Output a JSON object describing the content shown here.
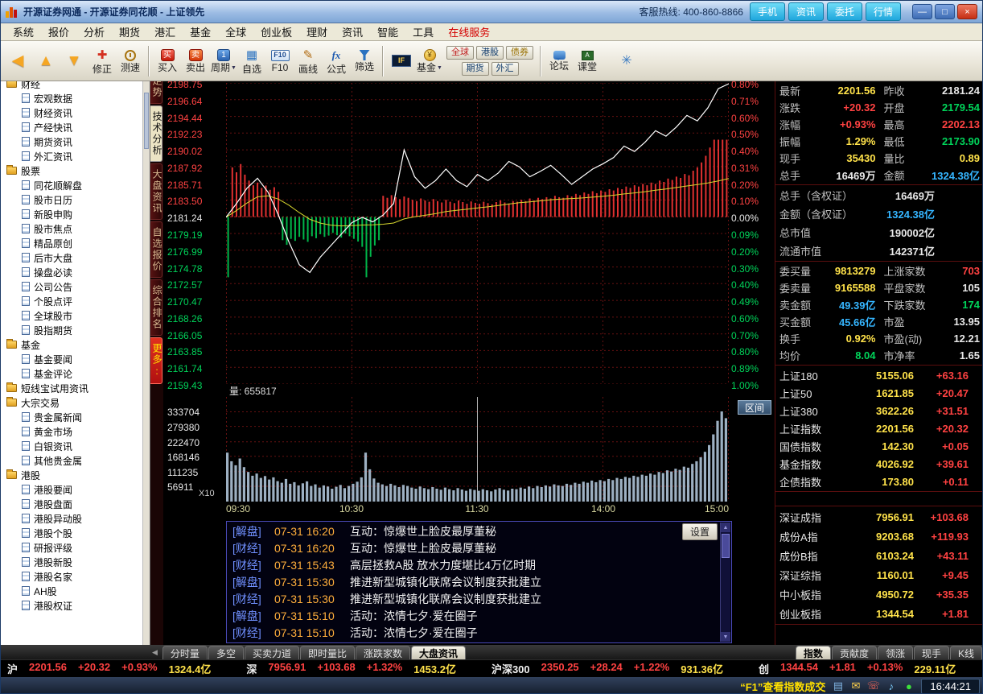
{
  "window": {
    "title": "开源证券网通 - 开源证券同花顺 - 上证领先",
    "hotline": "客服热线: 400-860-8866",
    "quick_buttons": [
      {
        "id": "mobile",
        "label": "手机"
      },
      {
        "id": "info",
        "label": "资讯"
      },
      {
        "id": "trade",
        "label": "委托"
      },
      {
        "id": "quotes",
        "label": "行情"
      }
    ],
    "controls": [
      {
        "id": "minimize",
        "glyph": "—"
      },
      {
        "id": "restore",
        "glyph": "□"
      },
      {
        "id": "close",
        "glyph": "×"
      }
    ]
  },
  "menubar": {
    "items": [
      {
        "id": "system",
        "label": "系统"
      },
      {
        "id": "quote",
        "label": "报价"
      },
      {
        "id": "analysis",
        "label": "分析"
      },
      {
        "id": "futures",
        "label": "期货"
      },
      {
        "id": "hk-fx",
        "label": "港汇"
      },
      {
        "id": "fund",
        "label": "基金"
      },
      {
        "id": "global",
        "label": "全球"
      },
      {
        "id": "chinext",
        "label": "创业板"
      },
      {
        "id": "wealth",
        "label": "理财"
      },
      {
        "id": "news",
        "label": "资讯"
      },
      {
        "id": "smart",
        "label": "智能"
      },
      {
        "id": "tools",
        "label": "工具"
      },
      {
        "id": "online-service",
        "label": "在线服务",
        "accent": true
      }
    ]
  },
  "toolbar": {
    "items": [
      {
        "type": "btn",
        "id": "back",
        "icon": "nav",
        "glyph": "◀"
      },
      {
        "type": "btn",
        "id": "home",
        "icon": "nav",
        "glyph": "▲"
      },
      {
        "type": "btn",
        "id": "forward",
        "icon": "nav",
        "glyph": "▼"
      },
      {
        "type": "btn",
        "id": "revise",
        "icon": "revise",
        "glyph": "✚",
        "label": "修正"
      },
      {
        "type": "btn",
        "id": "speed-test",
        "icon": "clock",
        "label": "测速"
      },
      {
        "type": "sep"
      },
      {
        "type": "btn",
        "id": "buy",
        "icon": "buy",
        "glyph": "买",
        "label": "买入"
      },
      {
        "type": "btn",
        "id": "sell",
        "icon": "sell",
        "glyph": "卖",
        "label": "卖出"
      },
      {
        "type": "btn",
        "id": "period",
        "icon": "period",
        "glyph": "1",
        "label": "周期",
        "dropdown": true
      },
      {
        "type": "btn",
        "id": "watchlist",
        "icon": "grid",
        "glyph": "▦",
        "label": "自选"
      },
      {
        "type": "btn",
        "id": "f10",
        "icon": "f10",
        "glyph": "F10",
        "label": "F10"
      },
      {
        "type": "btn",
        "id": "draw-line",
        "icon": "pencil",
        "glyph": "✎",
        "label": "画线"
      },
      {
        "type": "btn",
        "id": "formula",
        "icon": "fx",
        "glyph": "fx",
        "label": "公式"
      },
      {
        "type": "btn",
        "id": "screener",
        "icon": "funnel",
        "label": "筛选"
      },
      {
        "type": "sep"
      },
      {
        "type": "btn",
        "id": "index-futures",
        "icon": "if",
        "glyph": "IF"
      },
      {
        "type": "btn",
        "id": "fund",
        "icon": "coin",
        "glyph": "¥",
        "label": "基金",
        "dropdown": true
      },
      {
        "type": "group",
        "id": "market-shortcuts",
        "rows": [
          [
            {
              "id": "global",
              "label": "全球",
              "color": "#c02020"
            },
            {
              "id": "hk",
              "label": "港股",
              "color": "#103a6a"
            },
            {
              "id": "bond",
              "label": "债券",
              "color": "#9a7000"
            }
          ],
          [
            {
              "id": "futures",
              "label": "期货",
              "color": "#103a6a"
            },
            {
              "id": "fx",
              "label": "外汇",
              "color": "#103a6a"
            }
          ]
        ]
      },
      {
        "type": "sep"
      },
      {
        "type": "btn",
        "id": "forum",
        "icon": "forum",
        "label": "论坛"
      },
      {
        "type": "btn",
        "id": "classroom",
        "icon": "class",
        "glyph": "A",
        "label": "课堂"
      },
      {
        "type": "btn",
        "id": "settings",
        "icon": "gear",
        "glyph": "✳"
      }
    ]
  },
  "sidebar": {
    "items": [
      {
        "label": "财经",
        "level": 0
      },
      {
        "label": "宏观数据",
        "level": 1
      },
      {
        "label": "财经资讯",
        "level": 1
      },
      {
        "label": "产经快讯",
        "level": 1
      },
      {
        "label": "期货资讯",
        "level": 1
      },
      {
        "label": "外汇资讯",
        "level": 1
      },
      {
        "label": "股票",
        "level": 0
      },
      {
        "label": "同花顺解盘",
        "level": 1
      },
      {
        "label": "股市日历",
        "level": 1
      },
      {
        "label": "新股申购",
        "level": 1
      },
      {
        "label": "股市焦点",
        "level": 1
      },
      {
        "label": "精品原创",
        "level": 1
      },
      {
        "label": "后市大盘",
        "level": 1
      },
      {
        "label": "操盘必读",
        "level": 1
      },
      {
        "label": "公司公告",
        "level": 1
      },
      {
        "label": "个股点评",
        "level": 1
      },
      {
        "label": "全球股市",
        "level": 1
      },
      {
        "label": "股指期货",
        "level": 1
      },
      {
        "label": "基金",
        "level": 0
      },
      {
        "label": "基金要闻",
        "level": 1
      },
      {
        "label": "基金评论",
        "level": 1
      },
      {
        "label": "短线宝试用资讯",
        "level": 0
      },
      {
        "label": "大宗交易",
        "level": 0
      },
      {
        "label": "贵金属新闻",
        "level": 1
      },
      {
        "label": "黄金市场",
        "level": 1
      },
      {
        "label": "白银资讯",
        "level": 1
      },
      {
        "label": "其他贵金属",
        "level": 1
      },
      {
        "label": "港股",
        "level": 0
      },
      {
        "label": "港股要闻",
        "level": 1
      },
      {
        "label": "港股盘面",
        "level": 1
      },
      {
        "label": "港股异动股",
        "level": 1
      },
      {
        "label": "港股个股",
        "level": 1
      },
      {
        "label": "研报评级",
        "level": 1
      },
      {
        "label": "港股新股",
        "level": 1
      },
      {
        "label": "港股名家",
        "level": 1
      },
      {
        "label": "AH股",
        "level": 1
      },
      {
        "label": "港股权证",
        "level": 1
      }
    ]
  },
  "vertical_tabs": {
    "items": [
      {
        "id": "trend",
        "label": "走势"
      },
      {
        "id": "technical",
        "label": "技术分析",
        "selected": true
      },
      {
        "id": "market-info",
        "label": "大盘资讯"
      },
      {
        "id": "watchlist-quotes",
        "label": "自选报价"
      },
      {
        "id": "ranking",
        "label": "综合排名"
      },
      {
        "id": "more",
        "label": "更多:",
        "accent": true
      }
    ]
  },
  "chart_data": {
    "type": "intraday-line",
    "prev_close": 2181.24,
    "axis_top_value": 2198.75,
    "axis_bottom_value": 2159.43,
    "left_axis_labels": [
      "2198.75",
      "2196.64",
      "2194.44",
      "2192.23",
      "2190.02",
      "2187.92",
      "2185.71",
      "2183.50",
      "2181.24",
      "2179.19",
      "2176.99",
      "2174.78",
      "2172.57",
      "2170.47",
      "2168.26",
      "2166.05",
      "2163.85",
      "2161.74",
      "2159.43"
    ],
    "right_axis_labels": [
      "0.80%",
      "0.71%",
      "0.60%",
      "0.50%",
      "0.40%",
      "0.31%",
      "0.20%",
      "0.10%",
      "0.00%",
      "0.09%",
      "0.20%",
      "0.30%",
      "0.40%",
      "0.49%",
      "0.60%",
      "0.70%",
      "0.80%",
      "0.89%",
      "1.00%"
    ],
    "time_labels": [
      "09:30",
      "10:30",
      "11:30",
      "14:00",
      "15:00"
    ],
    "price_series": [
      2181.2,
      2183.0,
      2185.0,
      2186.3,
      2184.5,
      2181.5,
      2178.0,
      2175.0,
      2174.0,
      2176.0,
      2177.5,
      2179.0,
      2180.5,
      2181.2,
      2180.6,
      2181.5,
      2183.0,
      2190.0,
      2186.5,
      2185.0,
      2186.0,
      2187.5,
      2186.0,
      2185.2,
      2186.8,
      2186.0,
      2187.0,
      2188.5,
      2187.8,
      2186.5,
      2187.2,
      2188.0,
      2186.8,
      2185.5,
      2186.5,
      2187.5,
      2188.2,
      2189.0,
      2190.5,
      2189.8,
      2191.0,
      2192.5,
      2191.8,
      2193.0,
      2194.5,
      2193.8,
      2195.5,
      2198.0,
      2201.56
    ],
    "volume_series": [
      182000,
      150000,
      135000,
      160000,
      128000,
      110000,
      96000,
      104000,
      88000,
      95000,
      82000,
      90000,
      76000,
      70000,
      84000,
      66000,
      72000,
      60000,
      68000,
      75000,
      58000,
      64000,
      52000,
      60000,
      56000,
      48000,
      55000,
      62000,
      50000,
      58000,
      66000,
      74000,
      90000,
      182000,
      120000,
      86000,
      70000,
      64000,
      58000,
      66000,
      60000,
      54000,
      62000,
      58000,
      52000,
      48000,
      56000,
      50000,
      46000,
      54000,
      48000,
      44000,
      52000,
      46000,
      42000,
      50000,
      45000,
      40000,
      47000,
      43000,
      40000,
      46000,
      42000,
      38000,
      45000,
      50000,
      44000,
      41000,
      48000,
      46000,
      52000,
      48000,
      56000,
      50000,
      58000,
      54000,
      60000,
      56000,
      64000,
      60000,
      58000,
      66000,
      62000,
      70000,
      66000,
      74000,
      70000,
      78000,
      72000,
      80000,
      76000,
      84000,
      80000,
      88000,
      84000,
      92000,
      88000,
      96000,
      92000,
      100000,
      96000,
      104000,
      100000,
      110000,
      106000,
      116000,
      112000,
      122000,
      118000,
      130000,
      126000,
      140000,
      150000,
      165000,
      185000,
      210000,
      250000,
      300000,
      335000,
      310000
    ],
    "volume_scale_labels": [
      "333704",
      "279380",
      "222470",
      "168146",
      "111235",
      "56911"
    ],
    "volume_readout": "量: 655817",
    "volume_multiplier_label": "X10",
    "range_button_label": "区间"
  },
  "news": {
    "settings_label": "设置",
    "items": [
      {
        "tag": "[解盘]",
        "time": "07-31 16:20",
        "text": "互动：惊爆世上脸皮最厚董秘"
      },
      {
        "tag": "[财经]",
        "time": "07-31 16:20",
        "text": "互动：惊爆世上脸皮最厚董秘"
      },
      {
        "tag": "[财经]",
        "time": "07-31 15:43",
        "text": "高层拯救A股 放水力度堪比4万亿时期"
      },
      {
        "tag": "[解盘]",
        "time": "07-31 15:30",
        "text": "推进新型城镇化联席会议制度获批建立"
      },
      {
        "tag": "[财经]",
        "time": "07-31 15:30",
        "text": "推进新型城镇化联席会议制度获批建立"
      },
      {
        "tag": "[解盘]",
        "time": "07-31 15:10",
        "text": "活动：浓情七夕·爱在圈子"
      },
      {
        "tag": "[财经]",
        "time": "07-31 15:10",
        "text": "活动：浓情七夕·爱在圈子"
      }
    ]
  },
  "right_panel": {
    "summary_pairs": [
      [
        {
          "l": "最新",
          "v": "2201.56",
          "c": "yellow"
        },
        {
          "l": "昨收",
          "v": "2181.24",
          "c": "white"
        }
      ],
      [
        {
          "l": "涨跌",
          "v": "+20.32",
          "c": "red"
        },
        {
          "l": "开盘",
          "v": "2179.54",
          "c": "green"
        }
      ],
      [
        {
          "l": "涨幅",
          "v": "+0.93%",
          "c": "red"
        },
        {
          "l": "最高",
          "v": "2202.13",
          "c": "red"
        }
      ],
      [
        {
          "l": "振幅",
          "v": "1.29%",
          "c": "yellow"
        },
        {
          "l": "最低",
          "v": "2173.90",
          "c": "green"
        }
      ],
      [
        {
          "l": "现手",
          "v": "35430",
          "c": "yellow"
        },
        {
          "l": "量比",
          "v": "0.89",
          "c": "yellow"
        }
      ],
      [
        {
          "l": "总手",
          "v": "16469万",
          "c": "white"
        },
        {
          "l": "金额",
          "v": "1324.38亿",
          "c": "cyan"
        }
      ]
    ],
    "totals": [
      {
        "l": "总手（含权证）",
        "v": "16469万",
        "c": "white"
      },
      {
        "l": "金额（含权证）",
        "v": "1324.38亿",
        "c": "cyan"
      },
      {
        "l": "总市值",
        "v": "190002亿",
        "c": "white"
      },
      {
        "l": "流通市值",
        "v": "142371亿",
        "c": "white"
      }
    ],
    "detail_pairs": [
      [
        {
          "l": "委买量",
          "v": "9813279",
          "c": "yellow"
        },
        {
          "l": "上涨家数",
          "v": "703",
          "c": "red"
        }
      ],
      [
        {
          "l": "委卖量",
          "v": "9165588",
          "c": "yellow"
        },
        {
          "l": "平盘家数",
          "v": "105",
          "c": "white"
        }
      ],
      [
        {
          "l": "卖金额",
          "v": "49.39亿",
          "c": "cyan"
        },
        {
          "l": "下跌家数",
          "v": "174",
          "c": "green"
        }
      ],
      [
        {
          "l": "买金额",
          "v": "45.66亿",
          "c": "cyan"
        },
        {
          "l": "市盈",
          "v": "13.95",
          "c": "white"
        }
      ],
      [
        {
          "l": "换手",
          "v": "0.92%",
          "c": "yellow"
        },
        {
          "l": "市盈(动)",
          "v": "12.21",
          "c": "white"
        }
      ],
      [
        {
          "l": "均价",
          "v": "8.04",
          "c": "green"
        },
        {
          "l": "市净率",
          "v": "1.65",
          "c": "white"
        }
      ]
    ],
    "sh_indexes": [
      {
        "name": "上证180",
        "value": "5155.06",
        "change": "+63.16"
      },
      {
        "name": "上证50",
        "value": "1621.85",
        "change": "+20.47"
      },
      {
        "name": "上证380",
        "value": "3622.26",
        "change": "+31.51"
      },
      {
        "name": "上证指数",
        "value": "2201.56",
        "change": "+20.32"
      },
      {
        "name": "国债指数",
        "value": "142.30",
        "change": "+0.05"
      },
      {
        "name": "基金指数",
        "value": "4026.92",
        "change": "+39.61"
      },
      {
        "name": "企债指数",
        "value": "173.80",
        "change": "+0.11"
      }
    ],
    "sz_indexes": [
      {
        "name": "深证成指",
        "value": "7956.91",
        "change": "+103.68"
      },
      {
        "name": "成份A指",
        "value": "9203.68",
        "change": "+119.93"
      },
      {
        "name": "成份B指",
        "value": "6103.24",
        "change": "+43.11"
      },
      {
        "name": "深证综指",
        "value": "1160.01",
        "change": "+9.45"
      },
      {
        "name": "中小板指",
        "value": "4950.72",
        "change": "+35.35"
      },
      {
        "name": "创业板指",
        "value": "1344.54",
        "change": "+1.81"
      }
    ]
  },
  "bottom_tabs": {
    "left": [
      {
        "id": "minute-volume",
        "label": "分时量"
      },
      {
        "id": "long-short",
        "label": "多空"
      },
      {
        "id": "buy-sell-power",
        "label": "买卖力道"
      },
      {
        "id": "volume-ratio",
        "label": "即时量比"
      },
      {
        "id": "advance-decline",
        "label": "涨跌家数"
      },
      {
        "id": "market-news",
        "label": "大盘资讯",
        "selected": true
      }
    ],
    "right": [
      {
        "id": "indexes",
        "label": "指数",
        "selected": true
      },
      {
        "id": "contribution",
        "label": "贡献度"
      },
      {
        "id": "leaders",
        "label": "领涨"
      },
      {
        "id": "current-volume",
        "label": "现手"
      },
      {
        "id": "kline",
        "label": "K线"
      }
    ]
  },
  "quote_bar": {
    "groups": [
      {
        "id": "sh",
        "market": "沪",
        "price": "2201.56",
        "change": "+20.32",
        "pct": "+0.93%",
        "amount": "1324.4亿"
      },
      {
        "id": "sz",
        "market": "深",
        "price": "7956.91",
        "change": "+103.68",
        "pct": "+1.32%",
        "amount": "1453.2亿"
      },
      {
        "id": "hs300",
        "market": "沪深300",
        "price": "2350.25",
        "change": "+28.24",
        "pct": "+1.22%",
        "amount": "931.36亿"
      },
      {
        "id": "chinext",
        "market": "创",
        "price": "1344.54",
        "change": "+1.81",
        "pct": "+0.13%",
        "amount": "229.11亿"
      }
    ]
  },
  "status_bar": {
    "hint": "“F1”查看指数成交",
    "time": "16:44:21",
    "icons": [
      {
        "id": "board",
        "glyph": "▤",
        "color": "#7fb2e0"
      },
      {
        "id": "mail",
        "glyph": "✉",
        "color": "#ffd24d"
      },
      {
        "id": "phone",
        "glyph": "☏",
        "color": "#ff6a5a"
      },
      {
        "id": "sound",
        "glyph": "♪",
        "color": "#7fd0ff"
      },
      {
        "id": "signal",
        "glyph": "●",
        "color": "#3ce03c"
      }
    ]
  }
}
